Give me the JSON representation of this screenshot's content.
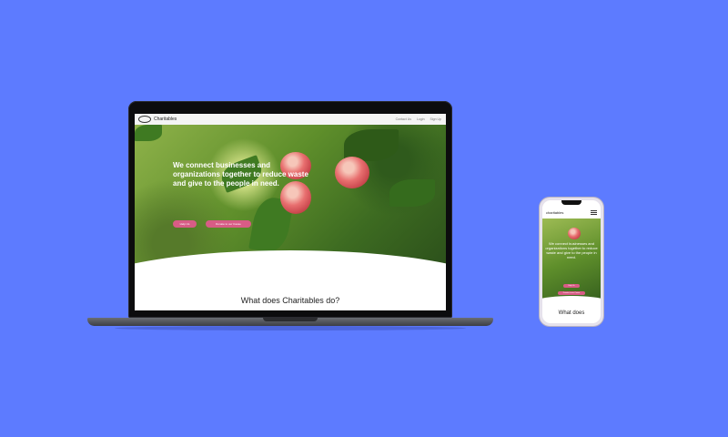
{
  "desktop": {
    "brand": "Charitables",
    "nav_links": [
      "Contact Us",
      "Login",
      "Sign Up"
    ],
    "headline": "We connect businesses and organizations together to reduce waste and give to the people in need.",
    "buttons": [
      "Help Us",
      "Donate to our Cause"
    ],
    "section_title": "What does Charitables do?"
  },
  "mobile": {
    "brand": "charitables",
    "headline": "We connect businesses and organizations together to reduce waste and give to the people in need.",
    "buttons": [
      "Help Us",
      "Donate to our Cause"
    ],
    "section_title": "What does"
  },
  "icons": {
    "logo": "charitables-logo-icon",
    "menu": "hamburger-menu-icon"
  },
  "colors": {
    "background": "#5d7bff",
    "accent": "#d85c86"
  }
}
